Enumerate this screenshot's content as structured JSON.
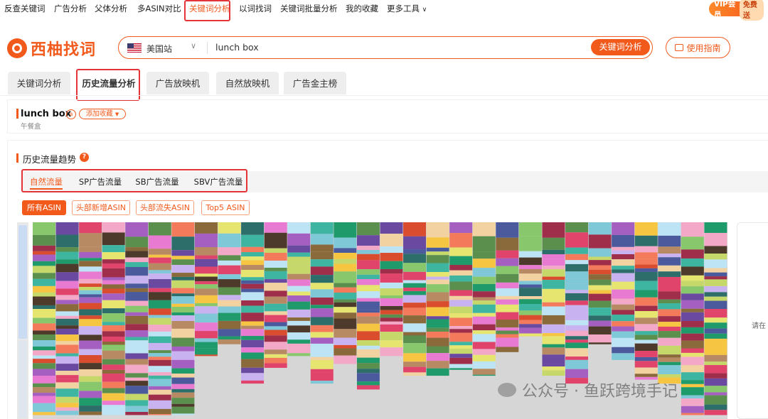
{
  "topnav": {
    "items": [
      "反查关键词",
      "广告分析",
      "父体分析",
      "多ASIN对比",
      "关键词分析",
      "以词找词",
      "关键词批量分析",
      "我的收藏",
      "更多工具"
    ],
    "active_index": 4,
    "vip_label": "VIP会员",
    "vip_free": "免费送"
  },
  "logo": {
    "text": "西柚找词"
  },
  "search": {
    "marketplace": "美国站",
    "query": "lunch box",
    "button": "关键词分析"
  },
  "guide_button": "使用指南",
  "tabs": [
    "关键词分析",
    "历史流量分析",
    "广告放映机",
    "自然放映机",
    "广告金主榜"
  ],
  "selected_tab": 1,
  "keyword": {
    "name": "lunch box",
    "badge": "a",
    "translation": "午餐盒",
    "add_favorite": "添加收藏"
  },
  "section": {
    "title": "历史流量趋势",
    "help": "?",
    "subtabs": [
      "自然流量",
      "SP广告流量",
      "SB广告流量",
      "SBV广告流量"
    ],
    "selected_subtab": 0,
    "filters": [
      "所有ASIN",
      "头部新增ASIN",
      "头部流失ASIN",
      "Top5 ASIN"
    ],
    "selected_filter": 0
  },
  "right_panel_hint": "请在",
  "watermark": "公众号 · 鱼跃跨境手记",
  "chart_data": {
    "type": "stacked-mosaic",
    "columns": 30,
    "column_stack_heights": [
      0.98,
      0.98,
      0.98,
      0.98,
      0.98,
      0.98,
      0.98,
      0.68,
      0.62,
      0.82,
      0.74,
      0.68,
      0.82,
      0.72,
      0.85,
      0.68,
      0.78,
      0.78,
      0.75,
      0.78,
      0.66,
      0.58,
      0.78,
      0.82,
      0.62,
      0.7,
      0.8,
      0.82,
      0.98,
      0.98
    ],
    "colors": [
      "#e0446b",
      "#c7d86a",
      "#b78a63",
      "#3db5a0",
      "#e5e56f",
      "#5a8f4e",
      "#f47a5c",
      "#7fc8d8",
      "#f3a8c8",
      "#a45fc0",
      "#2d6e6a",
      "#f6c542",
      "#9e2e4a",
      "#88c76c",
      "#4a5a9c",
      "#e87ad2",
      "#c9b2f0",
      "#8a6a3a",
      "#1f9a6a",
      "#f2d2a0",
      "#6a4aa0",
      "#d94c2e",
      "#bde4f4",
      "#4e3a2a"
    ]
  }
}
